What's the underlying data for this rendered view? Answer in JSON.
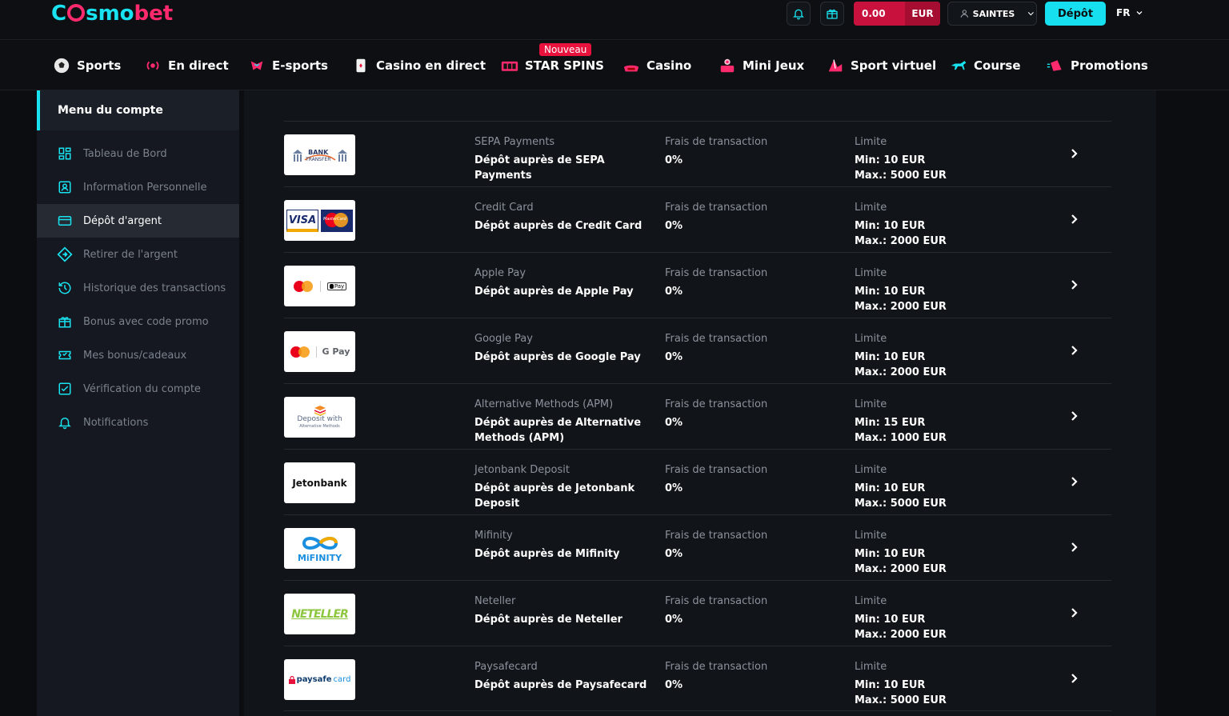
{
  "header": {
    "logo": {
      "c": "C",
      "smo": "smo",
      "bet": "bet"
    },
    "balance_amount": "0.00",
    "balance_currency": "EUR",
    "username": "SAINTES",
    "deposit_label": "Dépôt",
    "language": "FR"
  },
  "nav": {
    "items": [
      {
        "label": "Sports",
        "icon": "soccer-ball-icon"
      },
      {
        "label": "En direct",
        "icon": "live-icon"
      },
      {
        "label": "E-sports",
        "icon": "esports-icon"
      },
      {
        "label": "Casino en direct",
        "icon": "live-casino-icon"
      },
      {
        "label": "STAR SPINS",
        "icon": "slot-icon"
      },
      {
        "label": "Casino",
        "icon": "casino-icon"
      },
      {
        "label": "Mini Jeux",
        "icon": "mini-games-icon"
      },
      {
        "label": "Sport virtuel",
        "icon": "virtual-sport-icon"
      },
      {
        "label": "Course",
        "icon": "racing-icon"
      },
      {
        "label": "Promotions",
        "icon": "promotions-icon"
      }
    ],
    "new_badge": "Nouveau"
  },
  "sidebar": {
    "title": "Menu du compte",
    "items": [
      {
        "label": "Tableau de Bord",
        "icon": "dashboard-icon"
      },
      {
        "label": "Information Personnelle",
        "icon": "profile-icon"
      },
      {
        "label": "Dépôt d'argent",
        "icon": "credit-card-icon"
      },
      {
        "label": "Retirer de l'argent",
        "icon": "withdraw-icon"
      },
      {
        "label": "Historique des transactions",
        "icon": "history-icon"
      },
      {
        "label": "Bonus avec code promo",
        "icon": "gift-icon"
      },
      {
        "label": "Mes bonus/cadeaux",
        "icon": "ticket-icon"
      },
      {
        "label": "Vérification du compte",
        "icon": "checkbox-icon"
      },
      {
        "label": "Notifications",
        "icon": "bell-icon"
      }
    ]
  },
  "methods": [
    {
      "name": "SEPA Payments",
      "action_l1": "Dépôt auprès de SEPA Payments",
      "action_l2": "",
      "fee_label": "Frais de transaction",
      "fee": "0%",
      "limit_label": "Limite",
      "min": "Min: 10 EUR",
      "max": "Max.: 5000 EUR",
      "logo": {
        "t1": "BANK",
        "t2": "TRANSFER"
      }
    },
    {
      "name": "Credit Card",
      "action_l1": "Dépôt auprès de Credit Card",
      "action_l2": "",
      "fee_label": "Frais de transaction",
      "fee": "0%",
      "limit_label": "Limite",
      "min": "Min: 10 EUR",
      "max": "Max.: 2000 EUR",
      "logo": {
        "t1": "VISA",
        "t2": "MasterCard"
      }
    },
    {
      "name": "Apple Pay",
      "action_l1": "Dépôt auprès de Apple Pay",
      "action_l2": "",
      "fee_label": "Frais de transaction",
      "fee": "0%",
      "limit_label": "Limite",
      "min": "Min: 10 EUR",
      "max": "Max.: 2000 EUR",
      "logo": {
        "t1": "Pay",
        "t2": ""
      }
    },
    {
      "name": "Google Pay",
      "action_l1": "Dépôt auprès de Google Pay",
      "action_l2": "",
      "fee_label": "Frais de transaction",
      "fee": "0%",
      "limit_label": "Limite",
      "min": "Min: 10 EUR",
      "max": "Max.: 2000 EUR",
      "logo": {
        "t1": "G Pay",
        "t2": ""
      }
    },
    {
      "name": "Alternative Methods (APM)",
      "action_l1": "Dépôt auprès de Alternative",
      "action_l2": "Methods (APM)",
      "fee_label": "Frais de transaction",
      "fee": "0%",
      "limit_label": "Limite",
      "min": "Min: 15 EUR",
      "max": "Max.: 1000 EUR",
      "logo": {
        "t1": "Deposit with",
        "t2": "Alternative Methods"
      }
    },
    {
      "name": "Jetonbank Deposit",
      "action_l1": "Dépôt auprès de Jetonbank",
      "action_l2": "Deposit",
      "fee_label": "Frais de transaction",
      "fee": "0%",
      "limit_label": "Limite",
      "min": "Min: 10 EUR",
      "max": "Max.: 5000 EUR",
      "logo": {
        "t1": "Jetonbank",
        "t2": ""
      }
    },
    {
      "name": "Mifinity",
      "action_l1": "Dépôt auprès de Mifinity",
      "action_l2": "",
      "fee_label": "Frais de transaction",
      "fee": "0%",
      "limit_label": "Limite",
      "min": "Min: 10 EUR",
      "max": "Max.: 2000 EUR",
      "logo": {
        "t1": "MiFINITY",
        "t2": ""
      }
    },
    {
      "name": "Neteller",
      "action_l1": "Dépôt auprès de Neteller",
      "action_l2": "",
      "fee_label": "Frais de transaction",
      "fee": "0%",
      "limit_label": "Limite",
      "min": "Min: 10 EUR",
      "max": "Max.: 2000 EUR",
      "logo": {
        "t1": "NETELLER",
        "t2": ""
      }
    },
    {
      "name": "Paysafecard",
      "action_l1": "Dépôt auprès de Paysafecard",
      "action_l2": "",
      "fee_label": "Frais de transaction",
      "fee": "0%",
      "limit_label": "Limite",
      "min": "Min: 10 EUR",
      "max": "Max.: 5000 EUR",
      "logo": {
        "t1": "paysafe",
        "t2": "card"
      }
    }
  ],
  "colors": {
    "accent": "#19e3f0",
    "brand": "#ff2a6d",
    "balance": "#c8123d"
  }
}
